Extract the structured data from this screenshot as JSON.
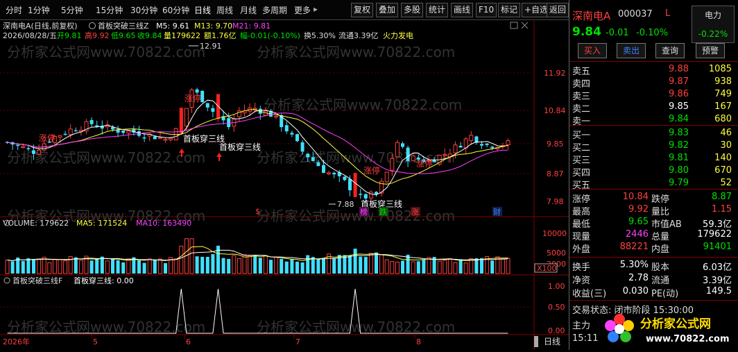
{
  "toolbar": {
    "periods": [
      "分时",
      "1分钟",
      "5分钟",
      "15分钟",
      "30分钟",
      "60分钟",
      "日线",
      "周线",
      "月线",
      "多周期",
      "更多"
    ],
    "more_arrow": "▸",
    "buttons": [
      "复权",
      "叠加",
      "多股",
      "统计",
      "画线",
      "F10",
      "标记",
      "+自选",
      "返回"
    ]
  },
  "chart": {
    "header_stock": "深南电A(日线,前复权)",
    "indicator_name": "首板突破三线Z",
    "ma5": "M5: 9.61",
    "ma13": "M13: 9.70",
    "ma21": "M21: 9.81",
    "info_date": "2026/08/28/五",
    "info_open": "开9.81",
    "info_high": "高9.92",
    "info_low": "低9.65",
    "info_close": "收9.84",
    "info_vol": "量179622",
    "info_amount": "额1.76亿",
    "info_change": "幅-0.01(-0.10%)",
    "info_turnover": "换5.30%",
    "info_float": "流通3.39亿",
    "info_concept": "火力发电",
    "price_labels": [
      "11.92",
      "10.84",
      "9.85",
      "8.87",
      "7.98"
    ],
    "high_mark": "12.91",
    "low_mark": "7.88",
    "zhangting_labels": [
      "涨停",
      "涨停",
      "涨停",
      "涨停"
    ],
    "signal_labels": [
      "首板穿三线",
      "首板穿三线",
      "首板穿三线"
    ],
    "event_tags": [
      {
        "text": "$",
        "color": "#ff4040"
      },
      {
        "text": "榜",
        "color": "#ff40ff"
      },
      {
        "text": "跌",
        "color": "#00e000"
      },
      {
        "text": "涨",
        "color": "#ff4040"
      },
      {
        "text": "财",
        "color": "#4080ff"
      }
    ],
    "volume_title": "VOLUME: 179622",
    "vol_ma5": "MA5: 171524",
    "vol_ma10": "MA10: 163490",
    "volume_labels": [
      "10000",
      "5000",
      "2000"
    ],
    "volume_unit": "X100",
    "sub_title": "首板突破三线F",
    "sub_value": "首板穿三线: 0.00",
    "sub_labels": [
      "1.00",
      "0.50",
      "0.00"
    ],
    "date_labels": [
      "2026年",
      "5",
      "6",
      "7",
      "8"
    ],
    "period_label": "日线",
    "watermark": "分析家公式网www.70822.com"
  },
  "panel": {
    "name": "深南电A",
    "code": "000037",
    "flag": "L",
    "sector": "电力",
    "sector_change": "-0.22%",
    "price": "9.84",
    "change": "-0.01",
    "change_pct": "-0.10%",
    "actions": [
      "买入",
      "卖出",
      "查询",
      "预警"
    ],
    "asks": [
      {
        "label": "卖五",
        "price": "9.88",
        "vol": "1085"
      },
      {
        "label": "卖四",
        "price": "9.87",
        "vol": "938"
      },
      {
        "label": "卖三",
        "price": "9.86",
        "vol": "749"
      },
      {
        "label": "卖二",
        "price": "9.85",
        "vol": "167"
      },
      {
        "label": "卖一",
        "price": "9.84",
        "vol": "680"
      }
    ],
    "bids": [
      {
        "label": "买一",
        "price": "9.83",
        "vol": "46"
      },
      {
        "label": "买二",
        "price": "9.82",
        "vol": "30"
      },
      {
        "label": "买三",
        "price": "9.81",
        "vol": "140"
      },
      {
        "label": "买四",
        "price": "9.80",
        "vol": "670"
      },
      {
        "label": "买五",
        "price": "9.79",
        "vol": "52"
      }
    ],
    "stats": [
      {
        "l1": "涨停",
        "v1": "10.84",
        "c1": "red",
        "l2": "跌停",
        "v2": "8.87",
        "c2": "green"
      },
      {
        "l1": "最高",
        "v1": "9.92",
        "c1": "red",
        "l2": "量比",
        "v2": "1.15",
        "c2": "red"
      },
      {
        "l1": "最低",
        "v1": "9.65",
        "c1": "green",
        "l2": "市值AB",
        "v2": "59.3亿",
        "c2": "white"
      },
      {
        "l1": "现量",
        "v1": "2446",
        "c1": "magenta",
        "l2": "总量",
        "v2": "179622",
        "c2": "white"
      },
      {
        "l1": "外盘",
        "v1": "88221",
        "c1": "red",
        "l2": "内盘",
        "v2": "91401",
        "c2": "green"
      }
    ],
    "stats2": [
      {
        "l1": "换手",
        "v1": "5.30%",
        "l2": "股本",
        "v2": "6.03亿"
      },
      {
        "l1": "净资",
        "v1": "2.78",
        "l2": "流通",
        "v2": "3.39亿"
      },
      {
        "l1": "收益(三)",
        "v1": "0.030",
        "l2": "PE(动)",
        "v2": "149.5"
      }
    ],
    "trade_status": "交易状态: 闭市阶段 15:30:00",
    "main_force": "主力",
    "time": "15:11",
    "logo_text": "分析家公式网",
    "logo_url": "www.70822.com"
  }
}
